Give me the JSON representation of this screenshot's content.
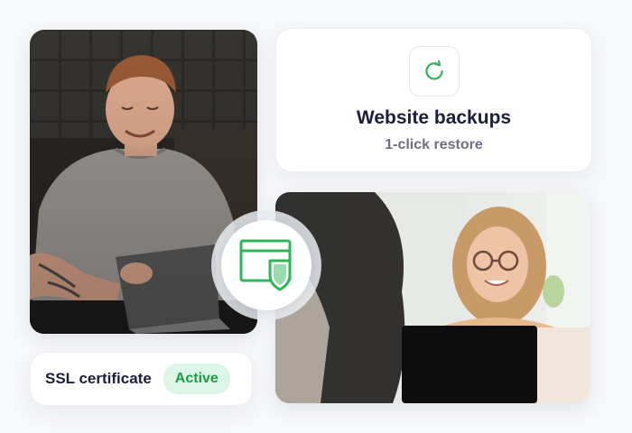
{
  "backup_card": {
    "icon": "restore-icon",
    "title": "Website backups",
    "subtitle": "1-click restore"
  },
  "ssl_card": {
    "label": "SSL certificate",
    "status": "Active"
  },
  "center_badge": {
    "icon": "browser-shield-icon"
  },
  "photos": {
    "man": "photo-man-with-laptop",
    "woman": "photo-woman-with-laptop"
  },
  "colors": {
    "accent_green": "#2fb55a",
    "status_green_text": "#1f9a4b",
    "status_green_bg": "#dcf5e6",
    "title_text": "#1d1e3a",
    "subtitle_text": "#6d7080",
    "page_bg": "#f7f8fa"
  }
}
